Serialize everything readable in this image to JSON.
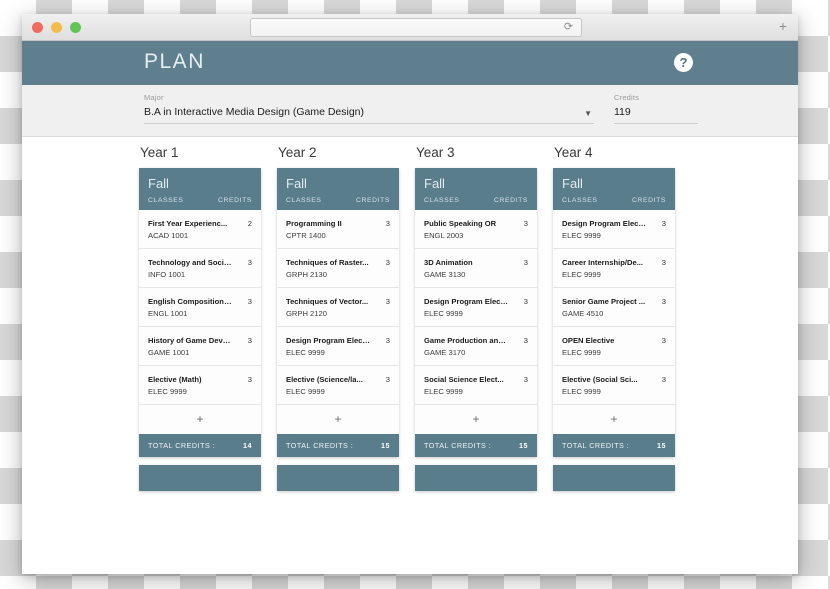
{
  "browser": {
    "address_value": "",
    "address_placeholder": "",
    "reload_icon": "reload-icon",
    "new_tab_label": "+"
  },
  "header": {
    "title": "PLAN",
    "help_label": "?",
    "bg_color": "#5f7f8e"
  },
  "form": {
    "major": {
      "label": "Major",
      "value": "B.A in Interactive Media Design (Game Design)",
      "caret": "▼"
    },
    "credits": {
      "label": "Credits",
      "value": "119"
    }
  },
  "theme": {
    "accent": "#5a7d8c",
    "card_bg": "#fdfdfd",
    "page_bg": "#ffffff"
  },
  "labels": {
    "classes": "CLASSES",
    "credits": "CREDITS",
    "total_credits": "TOTAL CREDITS :",
    "add_course": "+"
  },
  "years": [
    {
      "title": "Year 1",
      "terms": [
        {
          "name": "Fall",
          "total": "14",
          "courses": [
            {
              "name": "First Year Experienc...",
              "code": "ACAD 1001",
              "credits": "2"
            },
            {
              "name": "Technology and Socie...",
              "code": "INFO 1001",
              "credits": "3"
            },
            {
              "name": "English Composition ...",
              "code": "ENGL 1001",
              "credits": "3"
            },
            {
              "name": "History of Game Deve...",
              "code": "GAME 1001",
              "credits": "3"
            },
            {
              "name": "Elective (Math)",
              "code": "ELEC 9999",
              "credits": "3"
            }
          ]
        },
        {
          "name": "",
          "total": "",
          "courses": []
        }
      ]
    },
    {
      "title": "Year 2",
      "terms": [
        {
          "name": "Fall",
          "total": "15",
          "courses": [
            {
              "name": "Programming II",
              "code": "CPTR 1400",
              "credits": "3"
            },
            {
              "name": "Techniques of Raster...",
              "code": "GRPH 2130",
              "credits": "3"
            },
            {
              "name": "Techniques of Vector...",
              "code": "GRPH 2120",
              "credits": "3"
            },
            {
              "name": "Design Program Elect...",
              "code": "ELEC 9999",
              "credits": "3"
            },
            {
              "name": "Elective (Science/la...",
              "code": "ELEC 9999",
              "credits": "3"
            }
          ]
        },
        {
          "name": "",
          "total": "",
          "courses": []
        }
      ]
    },
    {
      "title": "Year 3",
      "terms": [
        {
          "name": "Fall",
          "total": "15",
          "courses": [
            {
              "name": "Public Speaking OR",
              "code": "ENGL 2003",
              "credits": "3"
            },
            {
              "name": "3D Animation",
              "code": "GAME 3130",
              "credits": "3"
            },
            {
              "name": "Design Program Elect...",
              "code": "ELEC 9999",
              "credits": "3"
            },
            {
              "name": "Game Production and ...",
              "code": "GAME 3170",
              "credits": "3"
            },
            {
              "name": "Social Science Elect...",
              "code": "ELEC 9999",
              "credits": "3"
            }
          ]
        },
        {
          "name": "",
          "total": "",
          "courses": []
        }
      ]
    },
    {
      "title": "Year 4",
      "terms": [
        {
          "name": "Fall",
          "total": "15",
          "courses": [
            {
              "name": "Design Program Elect...",
              "code": "ELEC 9999",
              "credits": "3"
            },
            {
              "name": "Career Internship/De...",
              "code": "ELEC 9999",
              "credits": "3"
            },
            {
              "name": "Senior Game Project ...",
              "code": "GAME 4510",
              "credits": "3"
            },
            {
              "name": "OPEN Elective",
              "code": "ELEC 9999",
              "credits": "3"
            },
            {
              "name": "Elective (Social Sci...",
              "code": "ELEC 9999",
              "credits": "3"
            }
          ]
        },
        {
          "name": "",
          "total": "",
          "courses": []
        }
      ]
    }
  ]
}
